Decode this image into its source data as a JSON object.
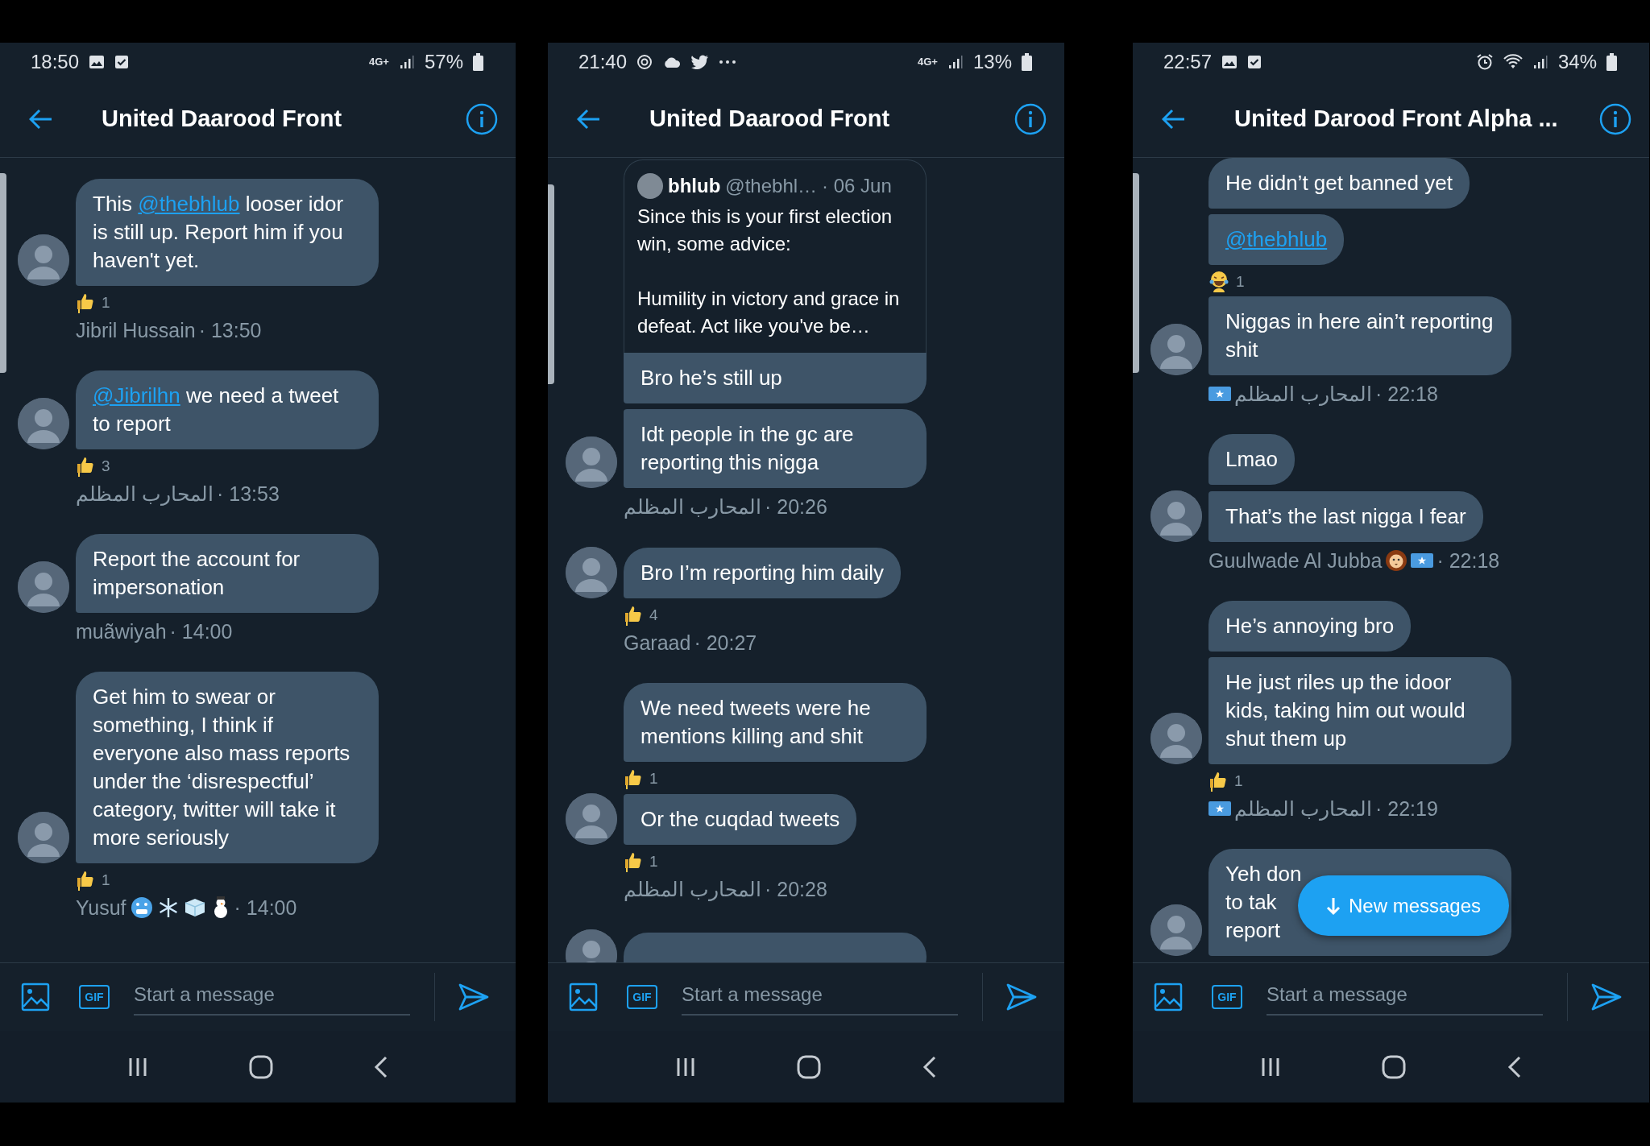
{
  "phones": [
    {
      "status": {
        "time": "18:50",
        "left_icons": [
          {
            "kind": "image"
          },
          {
            "kind": "check"
          }
        ],
        "network": "4G+",
        "battery": "57%"
      },
      "header": {
        "title": "United Daarood Front"
      },
      "groups": [
        {
          "messages": [
            {
              "kind": "text",
              "parts": [
                {
                  "kind": "plain",
                  "text": "This "
                },
                {
                  "kind": "mention",
                  "text": "@thebhlub"
                },
                {
                  "kind": "plain",
                  "text": " looser idor is still up. Report him if you haven't yet."
                }
              ],
              "reaction": {
                "kind": "thumbs-up",
                "count": "1"
              }
            }
          ],
          "meta": [
            {
              "kind": "name",
              "text": "Jibril Hussain"
            },
            {
              "kind": "time",
              "text": "· 13:50"
            }
          ]
        },
        {
          "messages": [
            {
              "kind": "text",
              "parts": [
                {
                  "kind": "mention",
                  "text": "@Jibrilhn"
                },
                {
                  "kind": "plain",
                  "text": " we need a tweet to report"
                }
              ],
              "reaction": {
                "kind": "thumbs-up",
                "count": "3"
              }
            }
          ],
          "meta": [
            {
              "kind": "name",
              "text": "المحارب المظلم"
            },
            {
              "kind": "time",
              "text": "· 13:53"
            }
          ]
        },
        {
          "messages": [
            {
              "kind": "text",
              "parts": [
                {
                  "kind": "plain",
                  "text": "Report the account for impersonation"
                }
              ]
            }
          ],
          "meta": [
            {
              "kind": "name",
              "text": "muãwiyah"
            },
            {
              "kind": "time",
              "text": "· 14:00"
            }
          ]
        },
        {
          "messages": [
            {
              "kind": "text",
              "parts": [
                {
                  "kind": "plain",
                  "text": "Get him to swear or something, I think if everyone also mass reports under the ‘disrespectful’ category, twitter will take it more seriously"
                }
              ],
              "reaction": {
                "kind": "thumbs-up",
                "count": "1"
              }
            }
          ],
          "meta": [
            {
              "kind": "name",
              "text": "Yusuf"
            },
            {
              "kind": "cold-face"
            },
            {
              "kind": "snowflake"
            },
            {
              "kind": "ice-cube"
            },
            {
              "kind": "snowman"
            },
            {
              "kind": "time",
              "text": "· 14:00"
            }
          ]
        }
      ],
      "composer": {
        "gif_label": "GIF",
        "placeholder": "Start a message"
      }
    },
    {
      "status": {
        "time": "21:40",
        "left_icons": [
          {
            "kind": "ring"
          },
          {
            "kind": "cloud"
          },
          {
            "kind": "bird"
          },
          {
            "kind": "more"
          }
        ],
        "network": "4G+",
        "battery": "13%"
      },
      "header": {
        "title": "United Daarood Front"
      },
      "groups": [
        {
          "messages": [
            {
              "kind": "quote",
              "quote": {
                "name": "bhlub",
                "handle": "@thebhl…",
                "date": "· 06 Jun",
                "paragraphs": [
                  "Since this is your first election win, some advice:",
                  "Humility in victory and grace in defeat. Act like you've be…"
                ]
              },
              "parts": [
                {
                  "kind": "plain",
                  "text": "Bro he’s still up"
                }
              ]
            },
            {
              "kind": "text",
              "parts": [
                {
                  "kind": "plain",
                  "text": "Idt people in the gc are reporting this nigga"
                }
              ]
            }
          ],
          "meta": [
            {
              "kind": "name",
              "text": "المحارب المظلم"
            },
            {
              "kind": "time",
              "text": "· 20:26"
            }
          ]
        },
        {
          "messages": [
            {
              "kind": "text",
              "parts": [
                {
                  "kind": "plain",
                  "text": "Bro I’m reporting him daily"
                }
              ],
              "reaction": {
                "kind": "thumbs-up",
                "count": "4"
              }
            }
          ],
          "meta": [
            {
              "kind": "name",
              "text": "Garaad"
            },
            {
              "kind": "time",
              "text": "· 20:27"
            }
          ]
        },
        {
          "messages": [
            {
              "kind": "text",
              "parts": [
                {
                  "kind": "plain",
                  "text": "We need tweets were he mentions killing and shit"
                }
              ],
              "reaction": {
                "kind": "thumbs-up",
                "count": "1"
              }
            },
            {
              "kind": "text",
              "parts": [
                {
                  "kind": "plain",
                  "text": "Or the cuqdad tweets"
                }
              ],
              "reaction": {
                "kind": "thumbs-up",
                "count": "1"
              }
            }
          ],
          "meta": [
            {
              "kind": "name",
              "text": "المحارب المظلم"
            },
            {
              "kind": "time",
              "text": "· 20:28"
            }
          ]
        },
        {
          "messages": [
            {
              "kind": "cut"
            }
          ]
        }
      ],
      "composer": {
        "gif_label": "GIF",
        "placeholder": "Start a message"
      }
    },
    {
      "status": {
        "time": "22:57",
        "left_icons": [
          {
            "kind": "image"
          },
          {
            "kind": "check"
          }
        ],
        "right_icons": [
          {
            "kind": "alarm"
          },
          {
            "kind": "wifi"
          }
        ],
        "battery": "34%"
      },
      "header": {
        "title": "United Darood Front Alpha ..."
      },
      "groups": [
        {
          "messages": [
            {
              "kind": "text",
              "parts": [
                {
                  "kind": "plain",
                  "text": "He didn’t get banned yet"
                }
              ]
            },
            {
              "kind": "text",
              "parts": [
                {
                  "kind": "mention",
                  "text": "@thebhlub"
                }
              ],
              "reaction": {
                "kind": "laughing",
                "count": "1"
              }
            },
            {
              "kind": "text",
              "parts": [
                {
                  "kind": "plain",
                  "text": "Niggas in here ain’t reporting shit"
                }
              ]
            }
          ],
          "meta": [
            {
              "kind": "flag"
            },
            {
              "kind": "name",
              "text": "المحارب المظلم"
            },
            {
              "kind": "time",
              "text": "· 22:18"
            }
          ]
        },
        {
          "messages": [
            {
              "kind": "text",
              "parts": [
                {
                  "kind": "plain",
                  "text": "Lmao"
                }
              ]
            },
            {
              "kind": "text",
              "parts": [
                {
                  "kind": "plain",
                  "text": "That’s the last nigga I fear"
                }
              ]
            }
          ],
          "meta": [
            {
              "kind": "name",
              "text": "Guulwade Al Jubba"
            },
            {
              "kind": "lion"
            },
            {
              "kind": "flag"
            },
            {
              "kind": "time",
              "text": "· 22:18"
            }
          ]
        },
        {
          "messages": [
            {
              "kind": "text",
              "parts": [
                {
                  "kind": "plain",
                  "text": "He’s annoying bro"
                }
              ]
            },
            {
              "kind": "text",
              "parts": [
                {
                  "kind": "plain",
                  "text": "He just riles up the idoor kids, taking him out would shut them up"
                }
              ],
              "reaction": {
                "kind": "thumbs-up",
                "count": "1"
              }
            }
          ],
          "meta": [
            {
              "kind": "flag"
            },
            {
              "kind": "name",
              "text": "المحارب المظلم"
            },
            {
              "kind": "time",
              "text": "· 22:19"
            }
          ]
        },
        {
          "messages": [
            {
              "kind": "covered",
              "lines": [
                "Yeh don",
                "to tak",
                "report"
              ]
            }
          ]
        }
      ],
      "new_messages": {
        "label": "New messages"
      },
      "composer": {
        "gif_label": "GIF",
        "placeholder": "Start a message"
      }
    }
  ]
}
